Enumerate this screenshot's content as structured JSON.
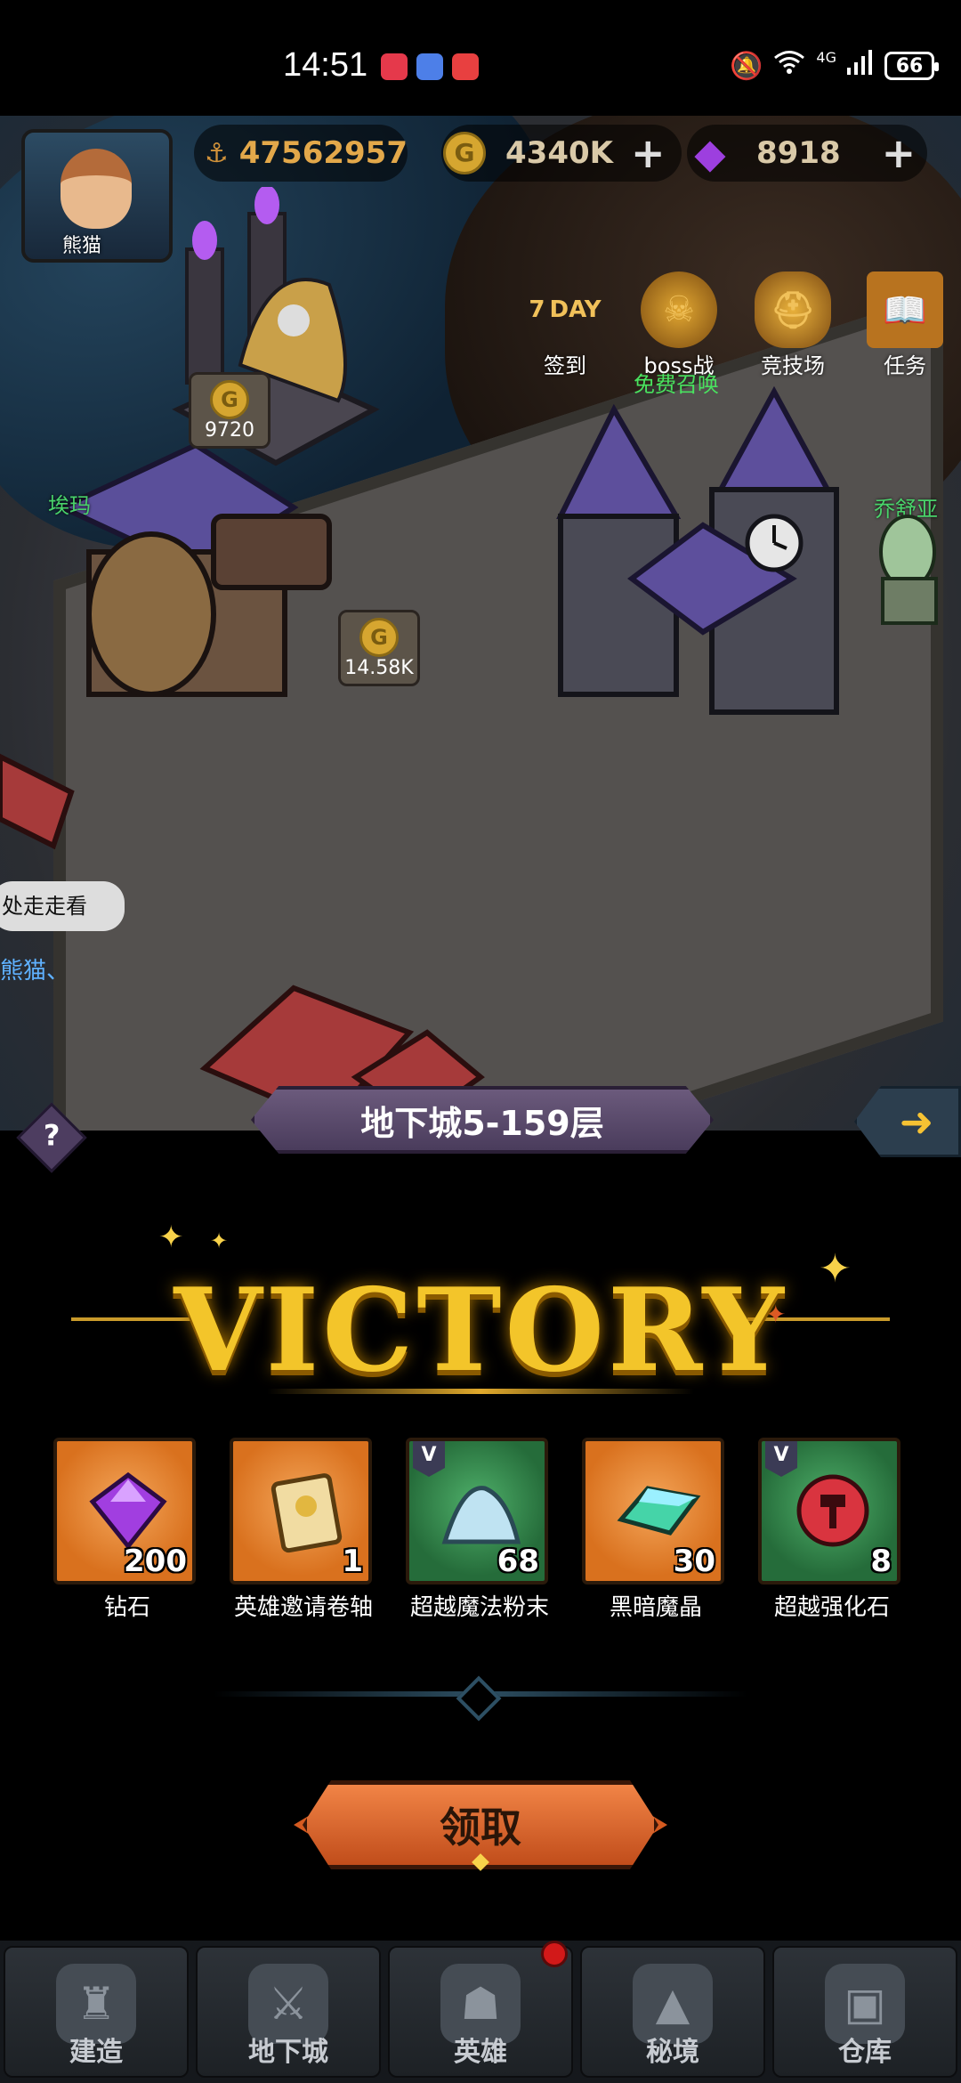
{
  "status_bar": {
    "time": "14:51",
    "battery": "66",
    "network": "4G"
  },
  "player": {
    "name": "熊猫",
    "power": "47562957"
  },
  "resources": {
    "gold": "4340K",
    "gems": "8918"
  },
  "top_menu": [
    {
      "label": "签到",
      "badge": "7 DAY"
    },
    {
      "label": "boss战",
      "sub": "免费召唤"
    },
    {
      "label": "竞技场"
    },
    {
      "label": "任务"
    }
  ],
  "buildings": {
    "tavern_coin": "9720",
    "house_coin": "14.58K"
  },
  "npcs": {
    "left": "埃玛",
    "right": "乔舒亚",
    "speech": "处走走看",
    "player_tag": "熊猫、"
  },
  "stage": {
    "title": "地下城5-159层"
  },
  "victory": {
    "title": "VICTORY",
    "rewards": [
      {
        "name": "钻石",
        "count": "200",
        "bg": "orange",
        "icon": "purple-gem-icon",
        "v": false
      },
      {
        "name": "英雄邀请卷轴",
        "count": "1",
        "bg": "orange",
        "icon": "scroll-icon",
        "v": false
      },
      {
        "name": "超越魔法粉末",
        "count": "68",
        "bg": "green",
        "icon": "magic-powder-icon",
        "v": true
      },
      {
        "name": "黑暗魔晶",
        "count": "30",
        "bg": "orange",
        "icon": "dark-crystal-icon",
        "v": false
      },
      {
        "name": "超越强化石",
        "count": "8",
        "bg": "green",
        "icon": "enhance-stone-icon",
        "v": true
      }
    ],
    "claim_label": "领取",
    "v_tag": "V"
  },
  "bottom_nav": [
    {
      "label": "建造",
      "icon": "castle-icon"
    },
    {
      "label": "地下城",
      "icon": "dungeon-icon"
    },
    {
      "label": "英雄",
      "icon": "hero-icon"
    },
    {
      "label": "秘境",
      "icon": "secret-realm-icon"
    },
    {
      "label": "仓库",
      "icon": "warehouse-icon"
    }
  ],
  "colors": {
    "accent_gold": "#f3c52a",
    "claim_orange": "#f18446",
    "npc_green": "#49d36a"
  }
}
